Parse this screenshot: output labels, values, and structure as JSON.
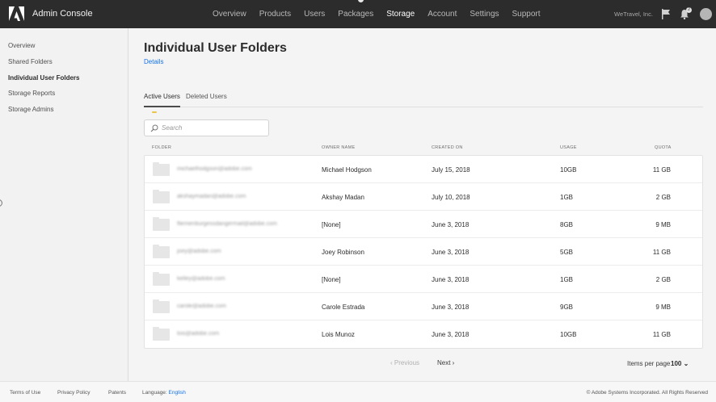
{
  "header": {
    "app_title": "Admin Console",
    "nav": [
      "Overview",
      "Products",
      "Users",
      "Packages",
      "Storage",
      "Account",
      "Settings",
      "Support"
    ],
    "active_nav": "Storage",
    "org_name": "WeTravel, Inc.",
    "notification_count": "2",
    "brand_color": "#2c2c2c"
  },
  "sidebar": {
    "items": [
      {
        "label": "Overview"
      },
      {
        "label": "Shared Folders"
      },
      {
        "label": "Individual User Folders"
      },
      {
        "label": "Storage Reports"
      },
      {
        "label": "Storage Admins"
      }
    ],
    "active": "Individual User Folders"
  },
  "main": {
    "title": "Individual User Folders",
    "details_link": "Details",
    "tabs": [
      {
        "label": "Active Users"
      },
      {
        "label": "Deleted Users"
      }
    ],
    "active_tab": "Active Users",
    "search": {
      "placeholder": "Search",
      "value": ""
    },
    "columns": [
      "FOLDER",
      "OWNER NAME",
      "CREATED ON",
      "USAGE",
      "QUOTA"
    ],
    "rows": [
      {
        "folder": "michaelhodgson@adobe.com",
        "owner": "Michael Hodgson",
        "created": "July 15, 2018",
        "usage": "10GB",
        "quota": "11 GB"
      },
      {
        "folder": "akshaymadan@adobe.com",
        "owner": "Akshay Madan",
        "created": "July 10, 2018",
        "usage": "1GB",
        "quota": "2 GB"
      },
      {
        "folder": "fliemenburgessdangermail@adobe.com",
        "owner": "[None]",
        "created": "June 3, 2018",
        "usage": "8GB",
        "quota": "9 MB"
      },
      {
        "folder": "joey@adobe.com",
        "owner": "Joey Robinson",
        "created": "June 3, 2018",
        "usage": "5GB",
        "quota": "11 GB"
      },
      {
        "folder": "kelley@adobe.com",
        "owner": "[None]",
        "created": "June 3, 2018",
        "usage": "1GB",
        "quota": "2 GB"
      },
      {
        "folder": "carole@adobe.com",
        "owner": "Carole Estrada",
        "created": "June 3, 2018",
        "usage": "9GB",
        "quota": "9 MB"
      },
      {
        "folder": "lois@adobe.com",
        "owner": "Lois Munoz",
        "created": "June 3, 2018",
        "usage": "10GB",
        "quota": "11 GB"
      }
    ],
    "pagination": {
      "previous": "Previous",
      "next": "Next",
      "items_per_page_label": "Items per page",
      "items_per_page_value": "100"
    }
  },
  "footer": {
    "terms": "Terms of Use",
    "privacy": "Privacy Policy",
    "patents": "Patents",
    "language_label": "Language:",
    "language_value": "English",
    "copyright": "© Adobe Systems Incorporated. All Rights Reserved"
  },
  "icons": [
    "adobe-logo-icon",
    "flag-icon",
    "bell-icon",
    "avatar",
    "search-icon",
    "folder-icon",
    "chevron-left-icon",
    "chevron-right-icon",
    "chevron-down-icon"
  ]
}
